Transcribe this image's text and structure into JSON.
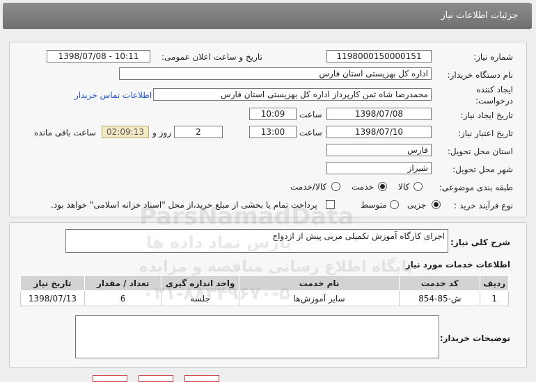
{
  "header": {
    "title": "جزئیات اطلاعات نیاز"
  },
  "form": {
    "need_number_label": "شماره نیاز:",
    "need_number": "1198000150000151",
    "announce_label": "تاریخ و ساعت اعلان عمومی:",
    "announce_value": "1398/07/08 - 10:11",
    "buyer_org_label": "نام دستگاه خریدار:",
    "buyer_org": "اداره کل بهزیستی استان فارس",
    "requester_label_1": "ایجاد کننده",
    "requester_label_2": "درخواست:",
    "requester": "محمدرضا شاه ثمن کارپرداز اداره کل بهزیستی استان فارس",
    "contact_link": "اطلاعات تماس خریدار",
    "created_label": "تاریخ ایجاد نیاز:",
    "created_date": "1398/07/08",
    "time_label": "ساعت",
    "created_time": "10:09",
    "validity_label": "تاریخ اعتبار نیاز:",
    "validity_date": "1398/07/10",
    "validity_time": "13:00",
    "days_value": "2",
    "days_label": "روز و",
    "remaining_time": "02:09:13",
    "remaining_label": "ساعت باقی مانده",
    "province_label": "استان محل تحویل:",
    "province": "فارس",
    "city_label": "شهر محل تحویل:",
    "city": "شیراز",
    "category_label": "طبقه بندی موضوعی:",
    "category_options": [
      "کالا",
      "خدمت",
      "کالا/خدمت"
    ],
    "category_selected": "خدمت",
    "process_label": "نوع فرآیند خرید :",
    "process_options": [
      "جزیی",
      "متوسط"
    ],
    "process_selected": "جزیی",
    "payment_note": "پرداخت تمام یا بخشی از مبلغ خرید،از محل \"اسناد خزانه اسلامی\" خواهد بود."
  },
  "description": {
    "label": "شرح کلی نیاز:",
    "value": "اجرای کارگاه آموزش تکمیلی مربی پیش از ازدواج"
  },
  "services": {
    "title": "اطلاعات خدمات مورد نیاز",
    "headers": [
      "ردیف",
      "کد خدمت",
      "نام خدمت",
      "واحد اندازه گیری",
      "تعداد / مقدار",
      "تاریخ نیاز"
    ],
    "rows": [
      [
        "1",
        "ش-85-854",
        "سایر آموزش‌ها",
        "جلسه",
        "6",
        "1398/07/13"
      ]
    ]
  },
  "buyer_notes": {
    "label": "توضیحات خریدار:",
    "value": ""
  },
  "watermark": {
    "line1": "ParsNamadData",
    "line2": "پارس نماد داده ها",
    "line3": "پایگاه اطلاع رسانی مناقصه و مزایده",
    "line4": "۰۲۱-۸۸۳۴۹۶۷۰-۵"
  }
}
